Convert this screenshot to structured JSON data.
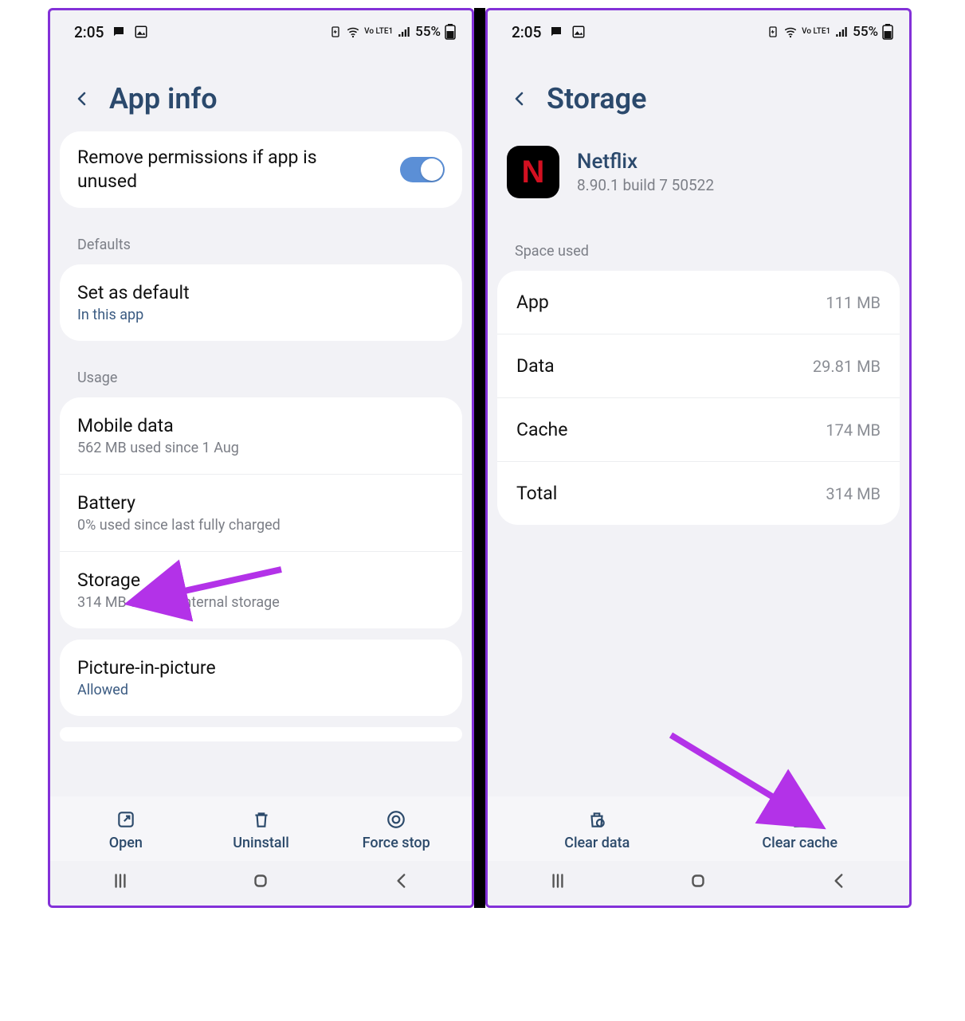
{
  "status": {
    "time": "2:05",
    "battery_pct": "55%",
    "network_label": "Vo LTE1"
  },
  "left": {
    "title": "App info",
    "remove_perms": "Remove permissions if app is unused",
    "section_defaults": "Defaults",
    "set_default_title": "Set as default",
    "set_default_sub": "In this app",
    "section_usage": "Usage",
    "mobile_data_title": "Mobile data",
    "mobile_data_sub": "562 MB used since 1 Aug",
    "battery_title": "Battery",
    "battery_sub": "0% used since last fully charged",
    "storage_title": "Storage",
    "storage_sub": "314 MB used in Internal storage",
    "pip_title": "Picture-in-picture",
    "pip_sub": "Allowed",
    "actions": {
      "open": "Open",
      "uninstall": "Uninstall",
      "force_stop": "Force stop"
    }
  },
  "right": {
    "title": "Storage",
    "app_name": "Netflix",
    "app_version": "8.90.1 build 7 50522",
    "section_space": "Space used",
    "rows": {
      "app_label": "App",
      "app_val": "111 MB",
      "data_label": "Data",
      "data_val": "29.81 MB",
      "cache_label": "Cache",
      "cache_val": "174 MB",
      "total_label": "Total",
      "total_val": "314 MB"
    },
    "actions": {
      "clear_data": "Clear data",
      "clear_cache": "Clear cache"
    }
  }
}
